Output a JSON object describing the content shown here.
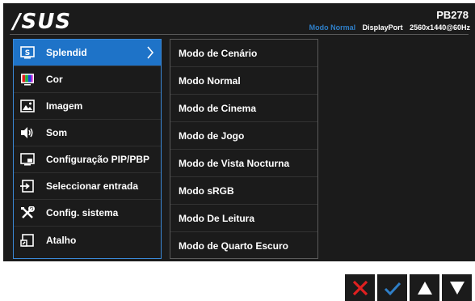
{
  "brand": {
    "logo_text": "/SUS"
  },
  "status": {
    "model": "PB278",
    "mode": "Modo Normal",
    "input": "DisplayPort",
    "resolution": "2560x1440@60Hz",
    "accent_color": "#2f7fc8"
  },
  "menu": {
    "selected_index": 0,
    "items": [
      {
        "label": "Splendid",
        "icon": "splendid-icon"
      },
      {
        "label": "Cor",
        "icon": "color-icon"
      },
      {
        "label": "Imagem",
        "icon": "image-icon"
      },
      {
        "label": "Som",
        "icon": "speaker-icon"
      },
      {
        "label": "Configuração PIP/PBP",
        "icon": "pip-icon"
      },
      {
        "label": "Seleccionar entrada",
        "icon": "input-icon"
      },
      {
        "label": "Config. sistema",
        "icon": "wrench-icon"
      },
      {
        "label": "Atalho",
        "icon": "shortcut-icon"
      }
    ]
  },
  "submenu": {
    "items": [
      "Modo de Cenário",
      "Modo Normal",
      "Modo de Cinema",
      "Modo de Jogo",
      "Modo de Vista Nocturna",
      "Modo sRGB",
      "Modo De Leitura",
      "Modo de Quarto Escuro"
    ]
  },
  "keys": [
    {
      "icon": "close-icon",
      "color": "#e02020"
    },
    {
      "icon": "check-icon",
      "color": "#2f7fc8"
    },
    {
      "icon": "up-arrow-icon",
      "color": "#ffffff"
    },
    {
      "icon": "down-arrow-icon",
      "color": "#ffffff"
    }
  ]
}
